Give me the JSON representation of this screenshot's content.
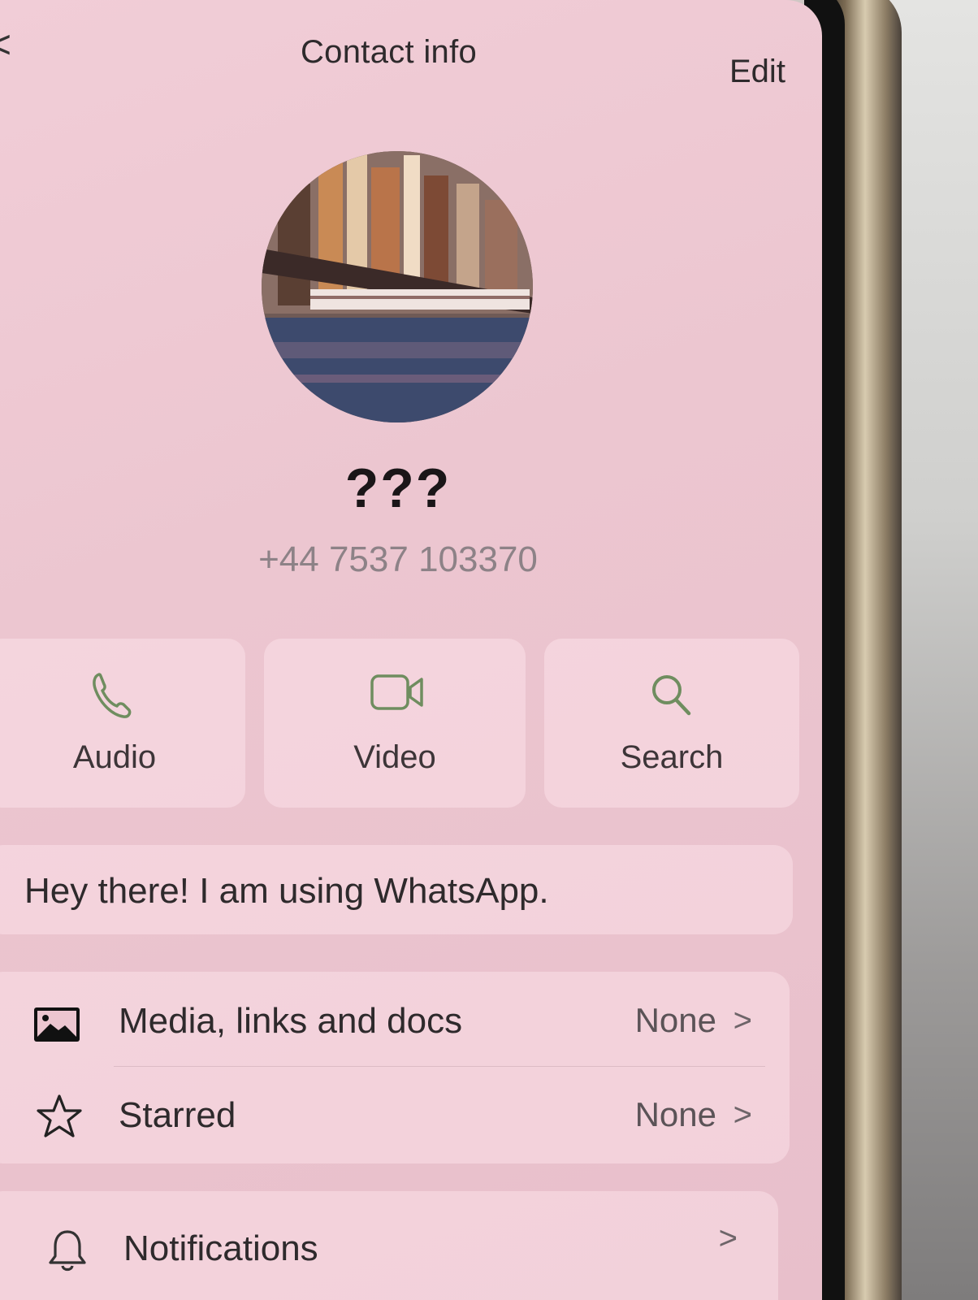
{
  "nav": {
    "back_glyph": "<",
    "title": "Contact info",
    "edit_label": "Edit"
  },
  "profile": {
    "name": "???",
    "phone": "+44 7537 103370"
  },
  "actions": [
    {
      "label": "Audio",
      "icon": "phone-icon"
    },
    {
      "label": "Video",
      "icon": "video-camera-icon"
    },
    {
      "label": "Search",
      "icon": "search-icon"
    }
  ],
  "about": {
    "text": "Hey there! I am using WhatsApp."
  },
  "list": [
    {
      "label": "Media, links and docs",
      "value": "None",
      "icon": "image-icon"
    },
    {
      "label": "Starred",
      "value": "None",
      "icon": "star-icon"
    },
    {
      "label": "Notifications",
      "value": "",
      "icon": "bell-icon"
    }
  ],
  "chevron_glyph": ">",
  "colors": {
    "accent_green": "#6f8d5f",
    "screen_tint": "#ecc6d0"
  }
}
